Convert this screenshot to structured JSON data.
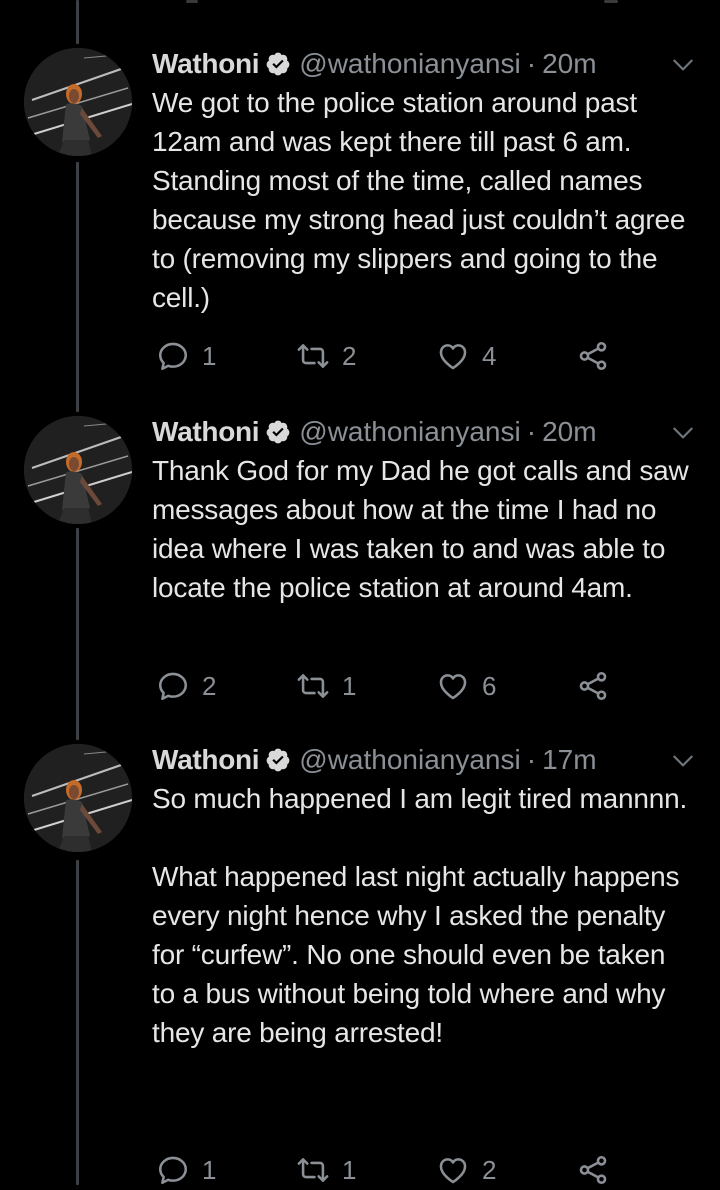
{
  "colors": {
    "background": "#000000",
    "text": "#e6e6e6",
    "muted": "#8b9096",
    "thread_line": "#3d4146"
  },
  "tweets": [
    {
      "name": "Wathoni",
      "handle": "@wathonianyansi",
      "separator": "·",
      "time": "20m",
      "text": "We got to the police station around past 12am and was kept there till past 6 am. Standing most of the time, called names because my strong head just couldn’t agree to (removing my slippers and going to the cell.)",
      "replies": "1",
      "retweets": "2",
      "likes": "4"
    },
    {
      "name": "Wathoni",
      "handle": "@wathonianyansi",
      "separator": "·",
      "time": "20m",
      "text": "Thank God for my Dad he got calls and saw messages about how at the time I had no idea where I was taken to and was able to locate the police station at around 4am.",
      "replies": "2",
      "retweets": "1",
      "likes": "6"
    },
    {
      "name": "Wathoni",
      "handle": "@wathonianyansi",
      "separator": "·",
      "time": "17m",
      "text": "So much happened I am legit tired mannnn.\n\nWhat happened last night actually happens every night hence why I asked the penalty for “curfew”. No one should even be taken to a bus without being told where and why they are being arrested!",
      "replies": "1",
      "retweets": "1",
      "likes": "2"
    }
  ],
  "icons": {
    "verified": "verified-badge-icon",
    "caret": "chevron-down-icon",
    "reply": "reply-icon",
    "retweet": "retweet-icon",
    "like": "heart-icon",
    "share": "share-icon"
  }
}
